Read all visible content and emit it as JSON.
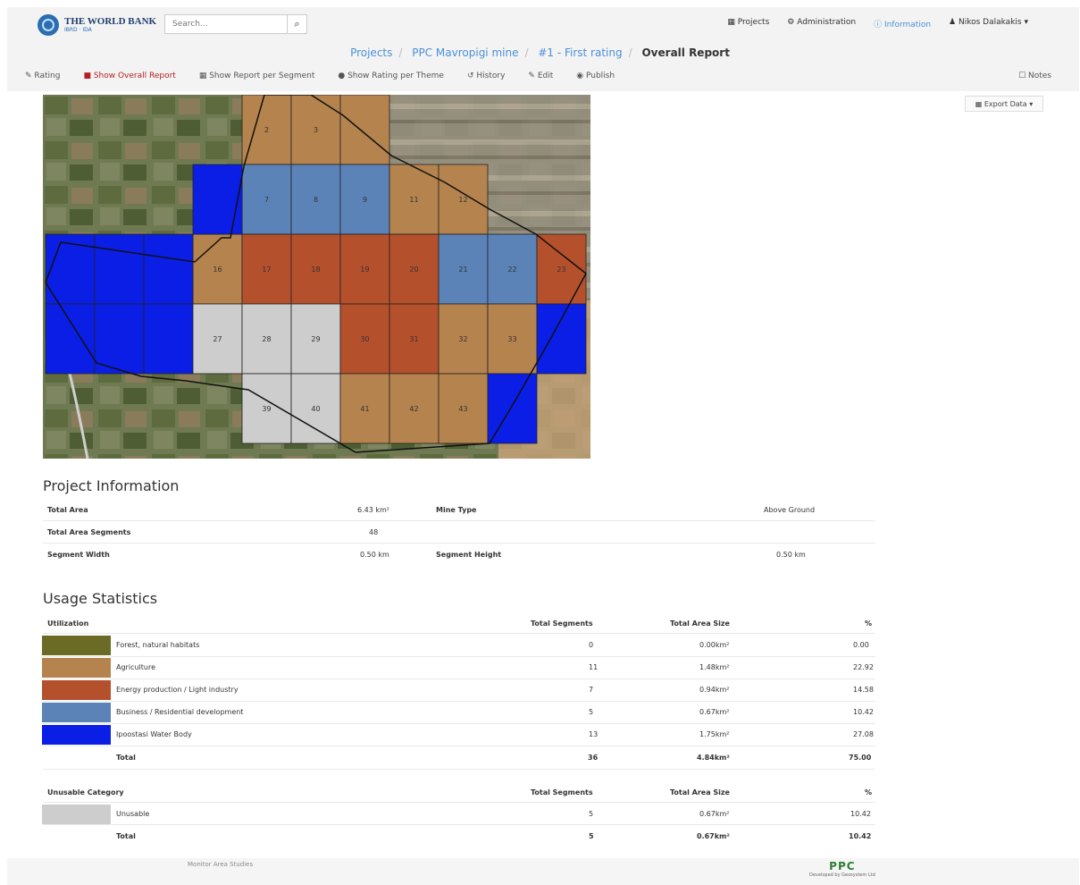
{
  "header": {
    "logo_title": "THE WORLD BANK",
    "logo_subtitle": "IBRD · IDA",
    "search_placeholder": "Search...",
    "nav": [
      "Projects",
      "Administration",
      "Information",
      "Nikos Dalakakis"
    ]
  },
  "breadcrumb": [
    "Projects",
    "PPC Mavropigi mine",
    "#1 - First rating",
    "Overall Report"
  ],
  "toolbar": {
    "items": [
      "Rating",
      "Show Overall Report",
      "Show Report per Segment",
      "Show Rating per Theme",
      "History",
      "Edit",
      "Publish"
    ],
    "active_index": 1,
    "notes": "Notes",
    "export": "Export Data"
  },
  "map": {
    "segments": [
      {
        "label": "2",
        "col": 4,
        "row": 0,
        "color": "agri"
      },
      {
        "label": "3",
        "col": 5,
        "row": 0,
        "color": "agri"
      },
      {
        "label": "",
        "col": 6,
        "row": 0,
        "color": "agri"
      },
      {
        "label": "7",
        "col": 4,
        "row": 1,
        "color": "business"
      },
      {
        "label": "8",
        "col": 5,
        "row": 1,
        "color": "business"
      },
      {
        "label": "9",
        "col": 6,
        "row": 1,
        "color": "business"
      },
      {
        "label": "11",
        "col": 7,
        "row": 1,
        "color": "agri"
      },
      {
        "label": "12",
        "col": 8,
        "row": 1,
        "color": "agri"
      },
      {
        "label": "16",
        "col": 3,
        "row": 2,
        "color": "agri"
      },
      {
        "label": "17",
        "col": 4,
        "row": 2,
        "color": "energy"
      },
      {
        "label": "18",
        "col": 5,
        "row": 2,
        "color": "energy"
      },
      {
        "label": "19",
        "col": 6,
        "row": 2,
        "color": "energy"
      },
      {
        "label": "20",
        "col": 7,
        "row": 2,
        "color": "energy"
      },
      {
        "label": "21",
        "col": 8,
        "row": 2,
        "color": "business"
      },
      {
        "label": "22",
        "col": 9,
        "row": 2,
        "color": "business"
      },
      {
        "label": "23",
        "col": 10,
        "row": 2,
        "color": "energy"
      },
      {
        "label": "",
        "col": 0,
        "row": 2,
        "color": "water"
      },
      {
        "label": "",
        "col": 1,
        "row": 2,
        "color": "water"
      },
      {
        "label": "",
        "col": 2,
        "row": 2,
        "color": "water"
      },
      {
        "label": "",
        "col": 0,
        "row": 3,
        "color": "water"
      },
      {
        "label": "",
        "col": 1,
        "row": 3,
        "color": "water"
      },
      {
        "label": "",
        "col": 2,
        "row": 3,
        "color": "water"
      },
      {
        "label": "27",
        "col": 3,
        "row": 3,
        "color": "unusable"
      },
      {
        "label": "28",
        "col": 4,
        "row": 3,
        "color": "unusable"
      },
      {
        "label": "29",
        "col": 5,
        "row": 3,
        "color": "unusable"
      },
      {
        "label": "30",
        "col": 6,
        "row": 3,
        "color": "energy"
      },
      {
        "label": "31",
        "col": 7,
        "row": 3,
        "color": "energy"
      },
      {
        "label": "32",
        "col": 8,
        "row": 3,
        "color": "agri"
      },
      {
        "label": "33",
        "col": 9,
        "row": 3,
        "color": "agri"
      },
      {
        "label": "",
        "col": 10,
        "row": 3,
        "color": "water"
      },
      {
        "label": "39",
        "col": 4,
        "row": 4,
        "color": "unusable"
      },
      {
        "label": "40",
        "col": 5,
        "row": 4,
        "color": "unusable"
      },
      {
        "label": "41",
        "col": 6,
        "row": 4,
        "color": "agri"
      },
      {
        "label": "42",
        "col": 7,
        "row": 4,
        "color": "agri"
      },
      {
        "label": "43",
        "col": 8,
        "row": 4,
        "color": "agri"
      },
      {
        "label": "",
        "col": 9,
        "row": 4,
        "color": "water"
      },
      {
        "label": "",
        "col": 3,
        "row": 1,
        "color": "water"
      }
    ]
  },
  "colors": {
    "forest": "#6b6b26",
    "agri": "#b5834d",
    "energy": "#b5502d",
    "business": "#5b83b8",
    "water": "#0a1ee6",
    "unusable": "#cdcdcd"
  },
  "project_info": {
    "title": "Project Information",
    "total_area_label": "Total Area",
    "total_area_value": "6.43 km²",
    "mine_type_label": "Mine Type",
    "mine_type_value": "Above Ground",
    "segments_label": "Total Area Segments",
    "segments_value": "48",
    "width_label": "Segment Width",
    "width_value": "0.50 km",
    "height_label": "Segment Height",
    "height_value": "0.50 km"
  },
  "usage": {
    "title": "Usage Statistics",
    "headers": [
      "Utilization",
      "Total Segments",
      "Total Area Size",
      "%"
    ],
    "rows": [
      {
        "name": "Forest, natural habitats",
        "segments": "0",
        "area": "0.00km²",
        "pct": "0.00",
        "color": "forest"
      },
      {
        "name": "Agriculture",
        "segments": "11",
        "area": "1.48km²",
        "pct": "22.92",
        "color": "agri"
      },
      {
        "name": "Energy production / Light industry",
        "segments": "7",
        "area": "0.94km²",
        "pct": "14.58",
        "color": "energy"
      },
      {
        "name": "Business / Residential development",
        "segments": "5",
        "area": "0.67km²",
        "pct": "10.42",
        "color": "business"
      },
      {
        "name": "Ipoostasi Water Body",
        "segments": "13",
        "area": "1.75km²",
        "pct": "27.08",
        "color": "water"
      }
    ],
    "total": {
      "label": "Total",
      "segments": "36",
      "area": "4.84km²",
      "pct": "75.00"
    }
  },
  "unusable": {
    "headers": [
      "Unusable Category",
      "Total Segments",
      "Total Area Size",
      "%"
    ],
    "rows": [
      {
        "name": "Unusable",
        "segments": "5",
        "area": "0.67km²",
        "pct": "10.42",
        "color": "unusable"
      }
    ],
    "total": {
      "label": "Total",
      "segments": "5",
      "area": "0.67km²",
      "pct": "10.42"
    }
  },
  "footer": {
    "left": "Monitor Area Studies",
    "logo": "PPC",
    "developed": "Developed by Geosystem Ltd"
  }
}
